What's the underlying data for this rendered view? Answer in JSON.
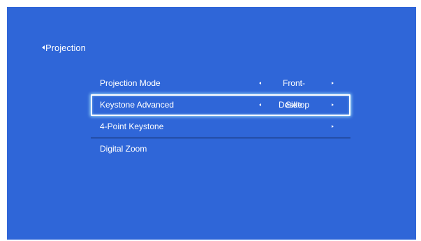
{
  "header": {
    "back_label": "Projection"
  },
  "menu": {
    "items": [
      {
        "label": "Projection Mode",
        "value": "Front-Desktop"
      },
      {
        "label": "Keystone Advanced",
        "value": "Side"
      },
      {
        "label": "4-Point Keystone",
        "value": ""
      },
      {
        "label": "Digital Zoom",
        "value": ""
      }
    ],
    "selected_index": 1
  },
  "colors": {
    "background": "#2f66d8",
    "text": "#ffffff",
    "selection_glow": "#aaebff",
    "divider": "#0d1f4a"
  },
  "icons": {
    "back": "triangle-left-icon",
    "prev": "triangle-left-icon",
    "next": "triangle-right-icon"
  }
}
